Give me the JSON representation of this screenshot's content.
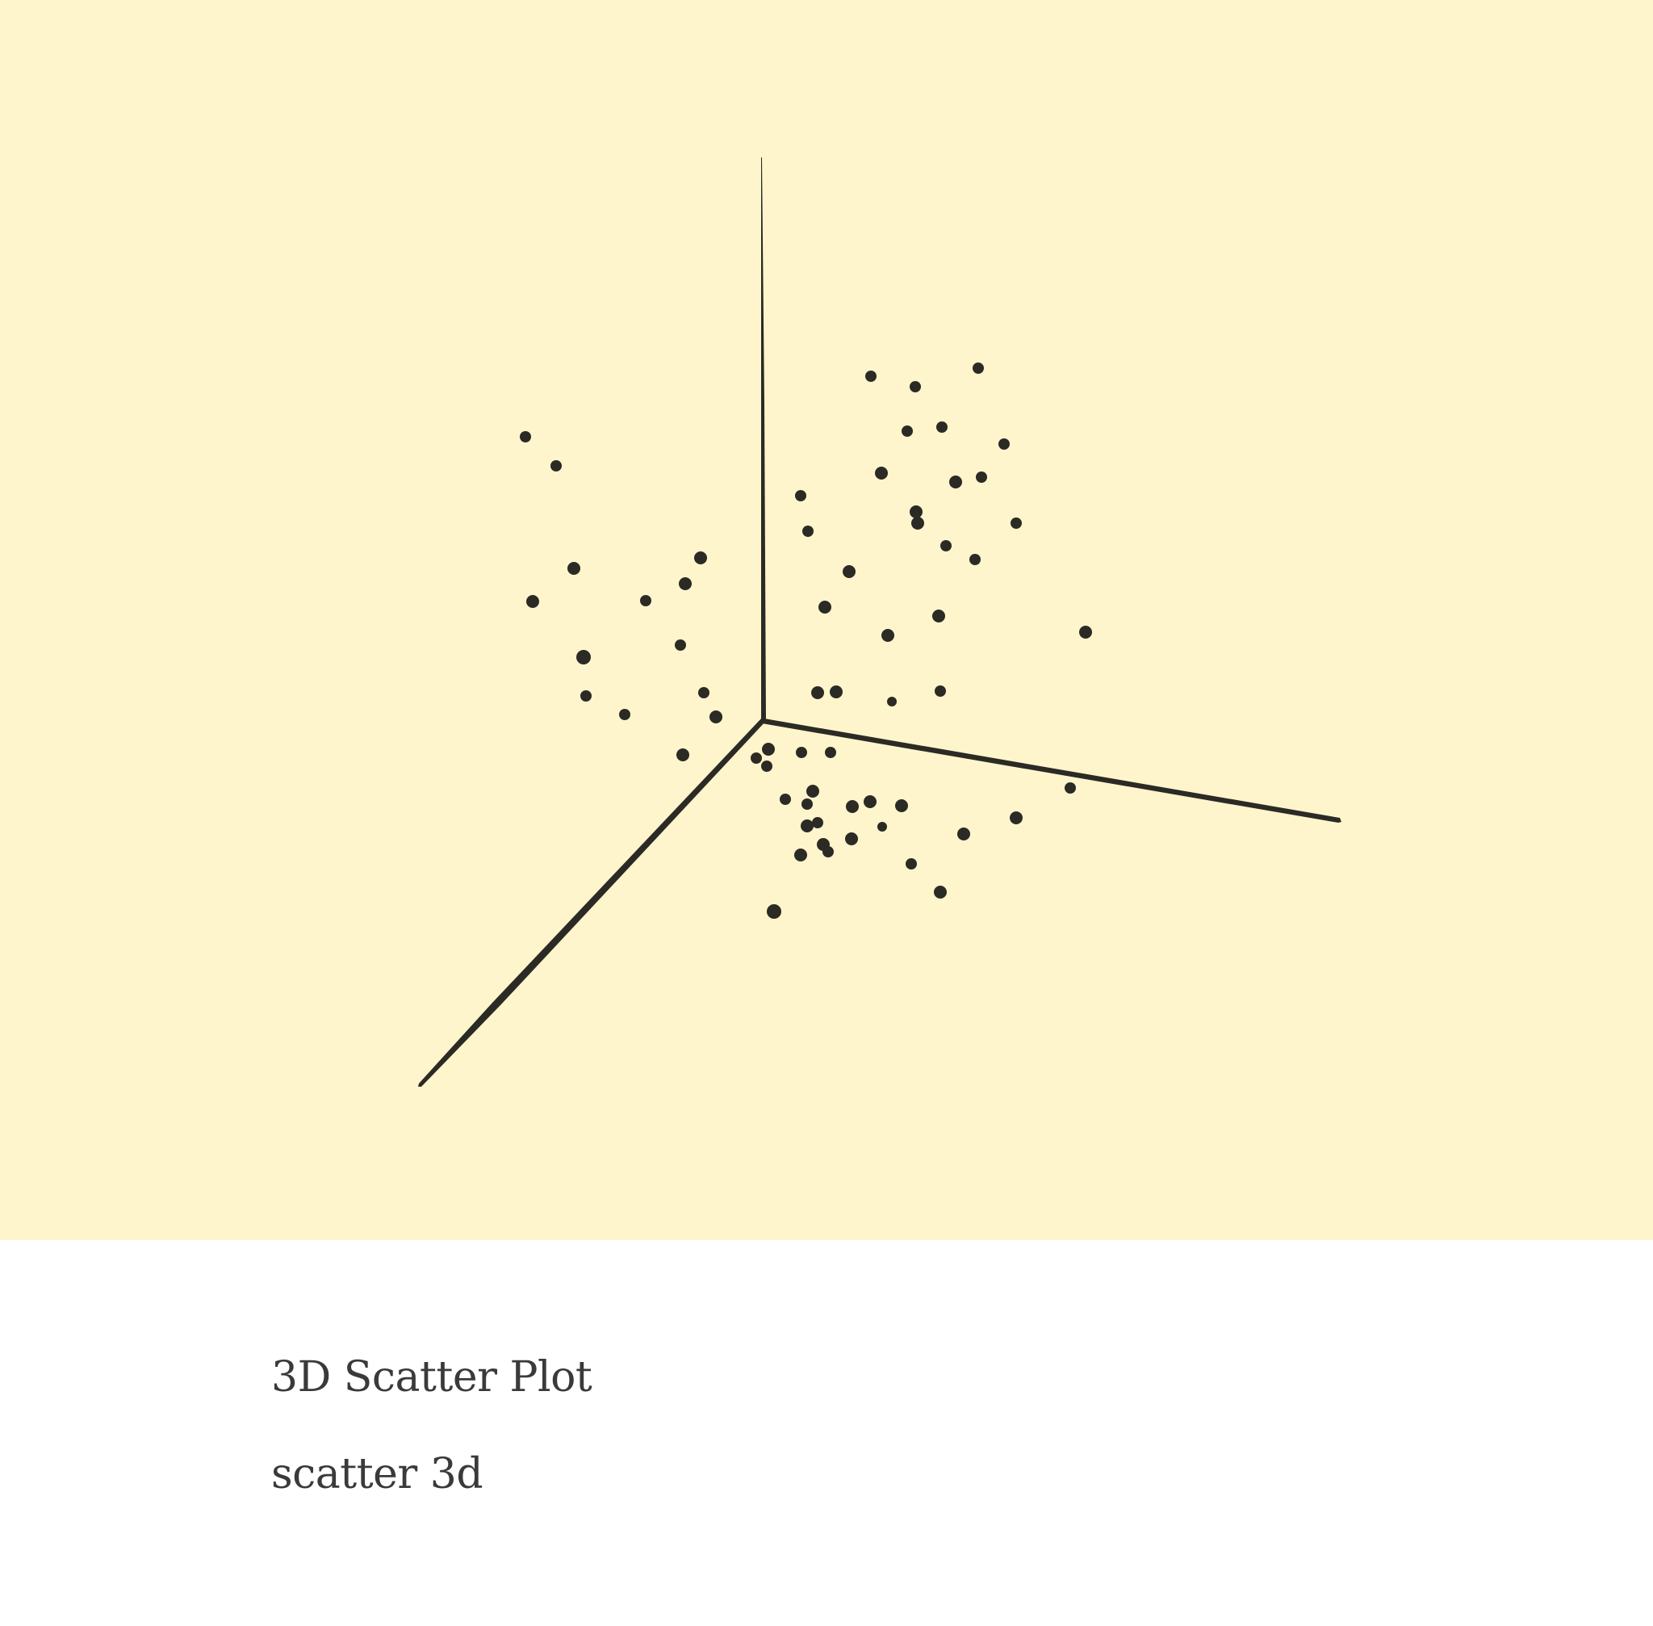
{
  "preview": {
    "background_color": "#fef5cc",
    "ink_color": "#2b2a25",
    "chart_data": {
      "type": "scatter",
      "grid": false,
      "point_count": 78
    }
  },
  "caption": {
    "title": "3D Scatter Plot",
    "subtitle": "scatter 3d",
    "text_color": "#3a3a3a"
  }
}
